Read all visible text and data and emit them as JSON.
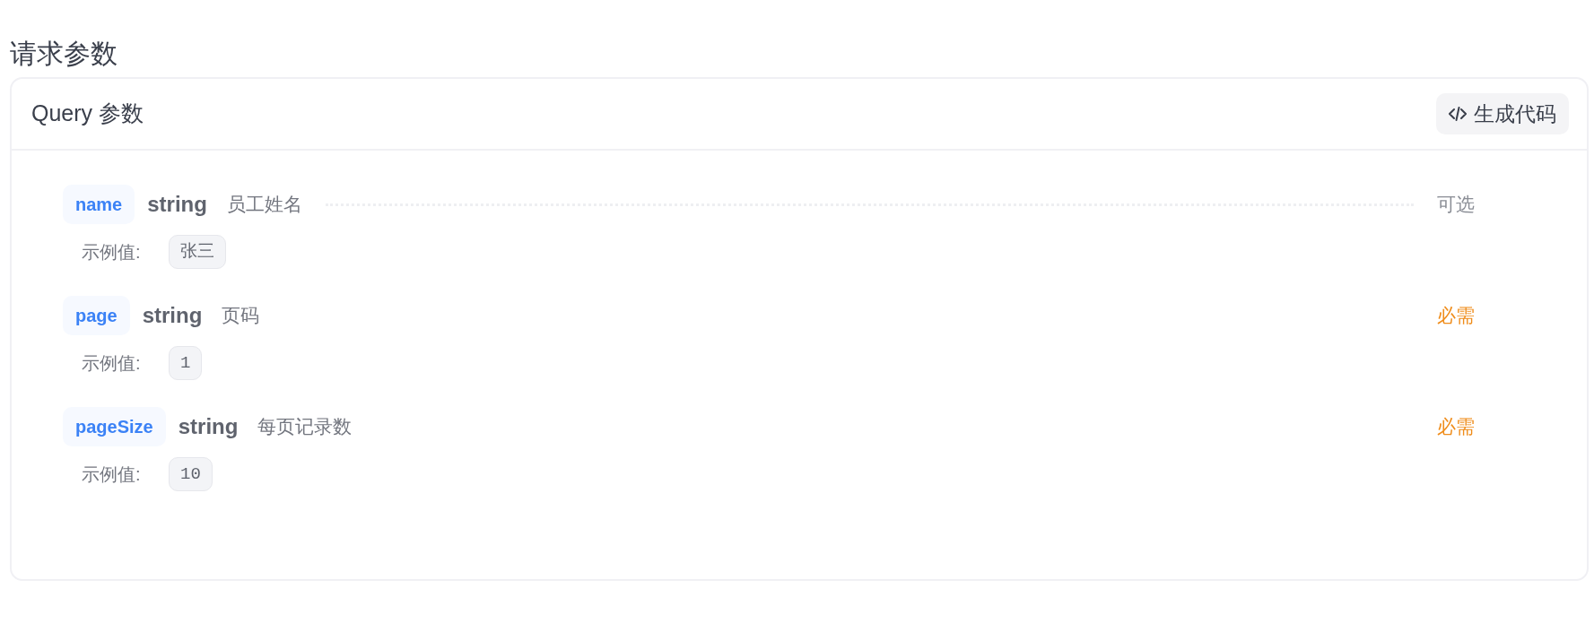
{
  "section_title": "请求参数",
  "card": {
    "title": "Query 参数",
    "generate_button": "生成代码"
  },
  "params": [
    {
      "name": "name",
      "type": "string",
      "description": "员工姓名",
      "requirement": "可选",
      "required": false,
      "hovered": true,
      "example_label": "示例值:",
      "example": "张三"
    },
    {
      "name": "page",
      "type": "string",
      "description": "页码",
      "requirement": "必需",
      "required": true,
      "hovered": false,
      "example_label": "示例值:",
      "example": "1"
    },
    {
      "name": "pageSize",
      "type": "string",
      "description": "每页记录数",
      "requirement": "必需",
      "required": true,
      "hovered": false,
      "example_label": "示例值:",
      "example": "10"
    }
  ]
}
